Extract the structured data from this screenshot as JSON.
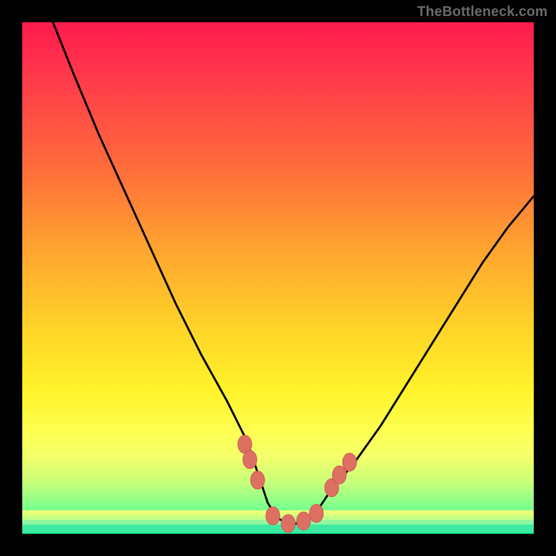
{
  "watermark": {
    "text": "TheBottleneck.com"
  },
  "chart_data": {
    "type": "line",
    "title": "",
    "xlabel": "",
    "ylabel": "",
    "xlim": [
      0,
      100
    ],
    "ylim": [
      0,
      100
    ],
    "series": [
      {
        "name": "curve",
        "x": [
          6,
          10,
          15,
          20,
          25,
          30,
          35,
          40,
          44,
          46,
          48,
          50,
          52,
          54,
          56,
          58,
          60,
          65,
          70,
          75,
          80,
          85,
          90,
          95,
          100
        ],
        "values": [
          100,
          90,
          78,
          67,
          56,
          45,
          35,
          26,
          18,
          12,
          6,
          3,
          2,
          2,
          3,
          5,
          8,
          14,
          21,
          29,
          37,
          45,
          53,
          60,
          66
        ]
      }
    ],
    "markers": [
      {
        "x": 43.5,
        "y": 17.5
      },
      {
        "x": 44.5,
        "y": 14.5
      },
      {
        "x": 46.0,
        "y": 10.5
      },
      {
        "x": 49.0,
        "y": 3.5
      },
      {
        "x": 52.0,
        "y": 2.0
      },
      {
        "x": 55.0,
        "y": 2.5
      },
      {
        "x": 57.5,
        "y": 4.0
      },
      {
        "x": 60.5,
        "y": 9.0
      },
      {
        "x": 62.0,
        "y": 11.5
      },
      {
        "x": 64.0,
        "y": 14.0
      }
    ],
    "bottom_band": {
      "stripes": [
        {
          "y": 4.0,
          "color": "#e8ff7a",
          "w": 1.2
        },
        {
          "y": 3.0,
          "color": "#c2ff86",
          "w": 1.2
        },
        {
          "y": 2.0,
          "color": "#8ef6a0",
          "w": 1.4
        },
        {
          "y": 1.0,
          "color": "#3ee9a0",
          "w": 1.6
        }
      ]
    },
    "colors": {
      "curve": "#000000",
      "marker": "#de6f63",
      "marker_outline": "#c75c52"
    }
  }
}
